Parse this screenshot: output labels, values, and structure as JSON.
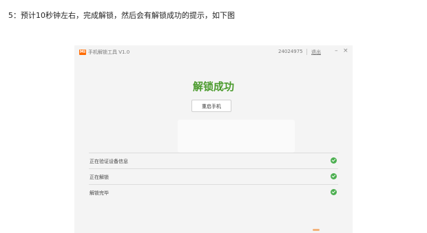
{
  "instruction": "5：预计10秒钟左右，完成解锁，然后会有解锁成功的提示，如下图",
  "window": {
    "logo": "MI",
    "title": "手机解锁工具 V1.0",
    "device_id": "24024975",
    "logout": "退出",
    "minimize": "–",
    "close": "×"
  },
  "headline": "解锁成功",
  "restart_button": "重启手机",
  "steps": [
    {
      "label": "正在验证设备信息",
      "status": "done"
    },
    {
      "label": "正在解锁",
      "status": "done"
    },
    {
      "label": "解锁完毕",
      "status": "done"
    }
  ],
  "colors": {
    "brand": "#ff6a00",
    "success": "#4a9a2c",
    "check": "#4caf50"
  },
  "icons": {
    "step_status": "check-circle-icon"
  }
}
